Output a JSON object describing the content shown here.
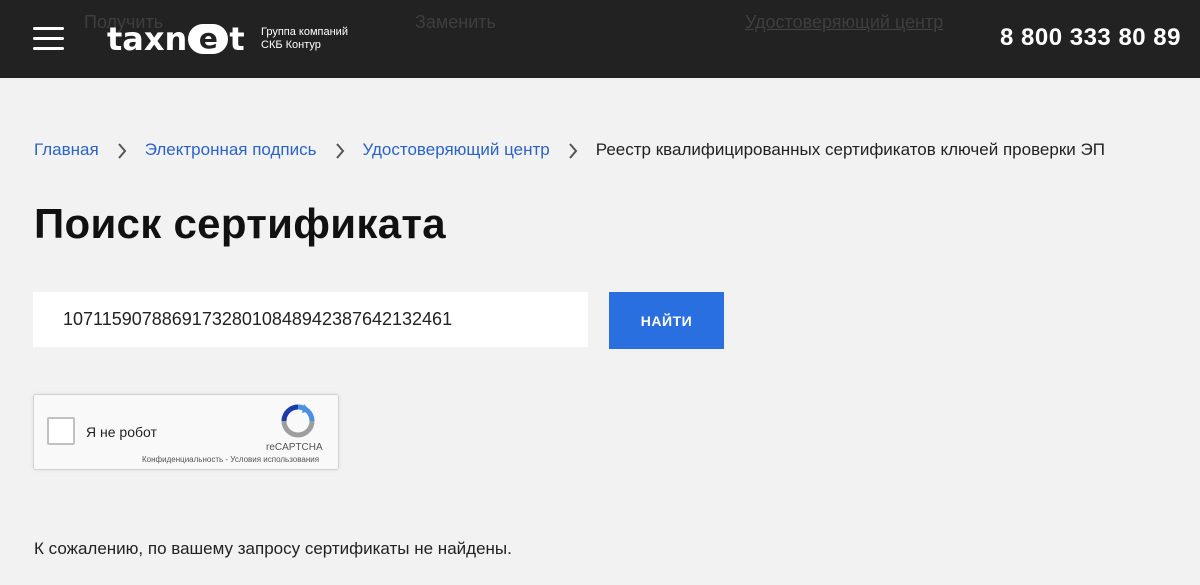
{
  "header": {
    "ghost_nav": [
      "Получить",
      "Заменить",
      "Удостоверяющий центр"
    ],
    "logo": {
      "part1": "taxn",
      "part_e": "e",
      "part2": "t"
    },
    "tagline_line1": "Группа компаний",
    "tagline_line2": "СКБ Контур",
    "phone": "8 800 333 80 89"
  },
  "breadcrumb": [
    {
      "label": "Главная"
    },
    {
      "label": "Электронная подпись"
    },
    {
      "label": "Удостоверяющий центр"
    },
    {
      "label": "Реестр квалифицированных сертификатов ключей проверки ЭП"
    }
  ],
  "page": {
    "title": "Поиск сертификата"
  },
  "search": {
    "value": "107115907886917328010848942387642132461",
    "button_label": "НАЙТИ"
  },
  "recaptcha": {
    "label": "Я не робот",
    "brand": "reCAPTCHA",
    "privacy": "Конфиденциальность",
    "separator": " - ",
    "terms": "Условия использования"
  },
  "result": {
    "message": "К сожалению, по вашему запросу сертификаты не найдены."
  },
  "colors": {
    "header_bg": "#222222",
    "link": "#2a63c9",
    "button": "#2a6fe0",
    "page_bg": "#f2f2f3"
  }
}
